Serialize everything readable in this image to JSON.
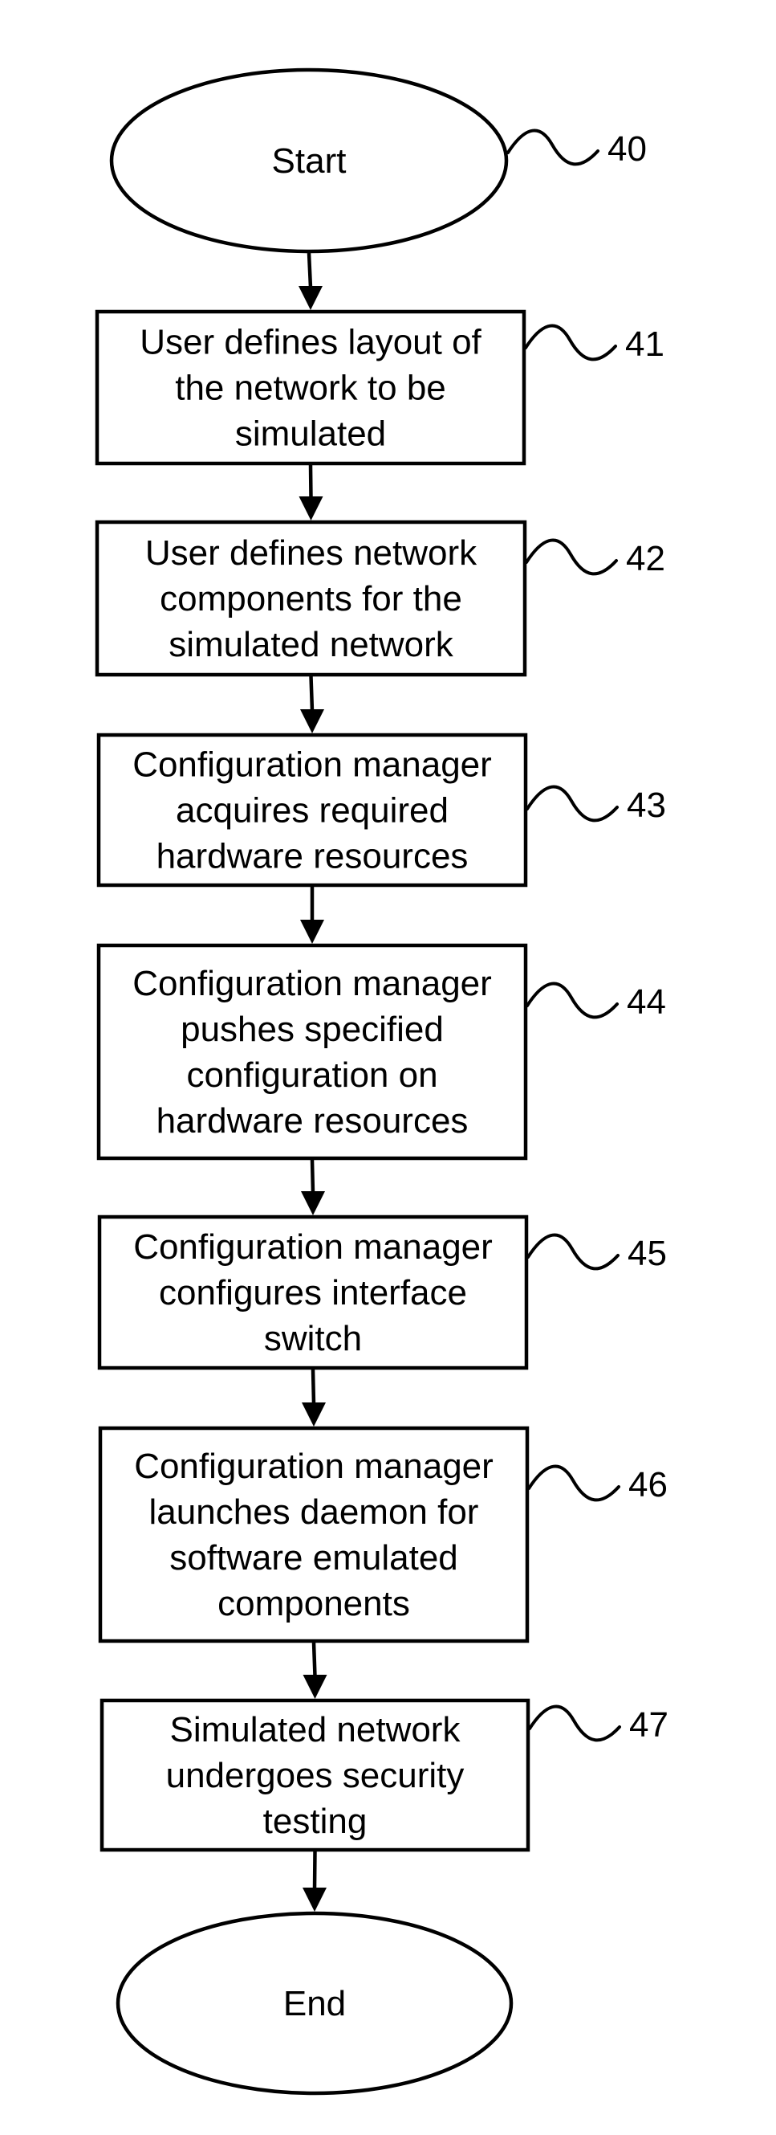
{
  "diagram": {
    "type": "flowchart",
    "direction": "top-to-bottom",
    "colors": {
      "stroke": "#000000",
      "fill": "#ffffff",
      "text": "#000000"
    },
    "nodes": [
      {
        "id": "40",
        "shape": "ellipse",
        "ref": "40",
        "lines": [
          "Start"
        ]
      },
      {
        "id": "41",
        "shape": "rect",
        "ref": "41",
        "lines": [
          "User defines layout of",
          "the network to be",
          "simulated"
        ]
      },
      {
        "id": "42",
        "shape": "rect",
        "ref": "42",
        "lines": [
          "User defines network",
          "components for the",
          "simulated network"
        ]
      },
      {
        "id": "43",
        "shape": "rect",
        "ref": "43",
        "lines": [
          "Configuration manager",
          "acquires required",
          "hardware resources"
        ]
      },
      {
        "id": "44",
        "shape": "rect",
        "ref": "44",
        "lines": [
          "Configuration manager",
          "pushes specified",
          "configuration on",
          "hardware resources"
        ]
      },
      {
        "id": "45",
        "shape": "rect",
        "ref": "45",
        "lines": [
          "Configuration manager",
          "configures interface",
          "switch"
        ]
      },
      {
        "id": "46",
        "shape": "rect",
        "ref": "46",
        "lines": [
          "Configuration manager",
          "launches daemon for",
          "software emulated",
          "components"
        ]
      },
      {
        "id": "47",
        "shape": "rect",
        "ref": "47",
        "lines": [
          "Simulated network",
          "undergoes security",
          "testing"
        ]
      },
      {
        "id": "end",
        "shape": "ellipse",
        "ref": "",
        "lines": [
          "End"
        ]
      }
    ],
    "edges": [
      {
        "from": "40",
        "to": "41"
      },
      {
        "from": "41",
        "to": "42"
      },
      {
        "from": "42",
        "to": "43"
      },
      {
        "from": "43",
        "to": "44"
      },
      {
        "from": "44",
        "to": "45"
      },
      {
        "from": "45",
        "to": "46"
      },
      {
        "from": "46",
        "to": "47"
      },
      {
        "from": "47",
        "to": "end"
      }
    ]
  }
}
